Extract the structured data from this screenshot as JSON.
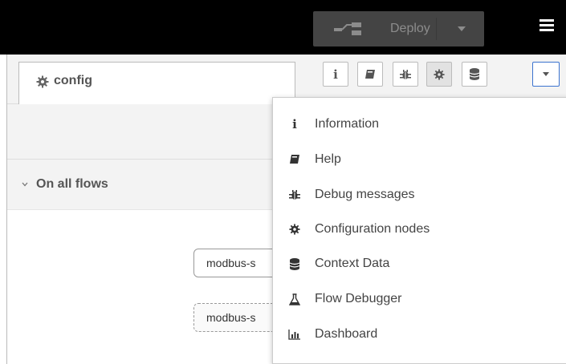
{
  "header": {
    "deploy_label": "Deploy",
    "deploy_icon": "deploy-icon",
    "menu_icon": "hamburger-menu-icon"
  },
  "sidebar": {
    "tab": {
      "label": "config",
      "icon": "gear-icon"
    },
    "buttons": [
      {
        "name": "info",
        "icon": "info-icon"
      },
      {
        "name": "help",
        "icon": "book-icon"
      },
      {
        "name": "debug",
        "icon": "bug-icon"
      },
      {
        "name": "config",
        "icon": "gear-icon",
        "active": true
      },
      {
        "name": "context",
        "icon": "database-icon"
      },
      {
        "name": "more",
        "icon": "caret-down-icon"
      }
    ],
    "section_title": "On all flows",
    "nodes": [
      {
        "label": "modbus-s"
      },
      {
        "label": "modbus-s"
      }
    ]
  },
  "menu": {
    "items": [
      {
        "label": "Information",
        "icon": "info-icon"
      },
      {
        "label": "Help",
        "icon": "book-icon"
      },
      {
        "label": "Debug messages",
        "icon": "bug-icon"
      },
      {
        "label": "Configuration nodes",
        "icon": "gear-icon"
      },
      {
        "label": "Context Data",
        "icon": "database-icon"
      },
      {
        "label": "Flow Debugger",
        "icon": "flask-icon"
      },
      {
        "label": "Dashboard",
        "icon": "bar-chart-icon"
      }
    ]
  },
  "colors": {
    "header_bg": "#000000",
    "deploy_bg": "#444444",
    "panel_bg": "#f3f3f3",
    "accent": "#3b73cf",
    "text": "#555555"
  }
}
